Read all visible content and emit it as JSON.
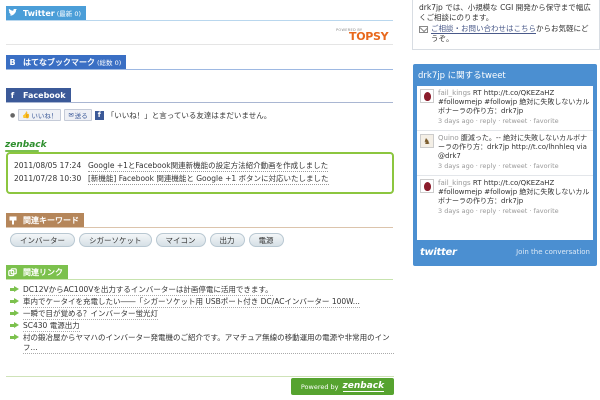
{
  "twitter_section": {
    "title": "Twitter",
    "count": "(最新 0)",
    "icon": "twitter-bird-icon",
    "topsy_powered": "POWERED BY",
    "topsy_logo": "TOPSY"
  },
  "hatena_section": {
    "title": "はてなブックマーク",
    "count": "(総数 0)",
    "icon": "hatena-b-icon"
  },
  "facebook_section": {
    "title": "Facebook",
    "icon": "facebook-f-icon",
    "like_label": "いいね！",
    "send_label": "送る",
    "message": "「いいね！」と言っている友達はまだいません。"
  },
  "zenback": {
    "logo": "zenback",
    "news": [
      {
        "date": "2011/08/05 17:24",
        "title": "Google +1とFacebook関連新機能の設定方法紹介動画を作成しました"
      },
      {
        "date": "2011/07/28 10:30",
        "title": "[新機能] Facebook 関連機能と Google +1 ボタンに対応いたしました"
      }
    ],
    "powered_by": "Powered by",
    "powered_logo": "zenback"
  },
  "keywords_section": {
    "title": "関連キーワード",
    "icon": "tag-icon",
    "items": [
      "インバーター",
      "シガーソケット",
      "マイコン",
      "出力",
      "電源"
    ]
  },
  "links_section": {
    "title": "関連リンク",
    "icon": "link-icon",
    "items": [
      "DC12VからAC100Vを出力するインバーターは計画停電に活用できます。",
      "車内でケータイを充電したい――「シガーソケット用 USBポート付き DC/ACインバーター 100W...",
      "一瞬で目が覚める？インバーター蛍光灯",
      "SC430 電源出力",
      "村の鍛冶屋からヤマハのインバーター発電機のご紹介です。アマチュア無線の移動運用の電源や非常用のインフ..."
    ]
  },
  "sidebar": {
    "contact_text_1": "drk7jp では、小規模な CGI 開発から保守まで幅広くご相談にのります。",
    "contact_link": "ご相談・お問い合わせはこちら",
    "contact_text_2": "からお気軽にどうぞ。",
    "widget_title": "drk7jp に関するtweet",
    "tweets": [
      {
        "user": "fail_kings",
        "text": "RT http://t.co/QKEZaHZ #followmejp #followjp 絶対に失敗しないカルボナーラの作り方：drk7jp",
        "meta": "3 days ago · reply · retweet · favorite",
        "avatar": "egg-avatar"
      },
      {
        "user": "Quino",
        "text": "腹減った。-- 絶対に失敗しないカルボナーラの作り方：drk7jp http://t.co/lhnhleq via @drk7",
        "meta": "3 days ago · reply · retweet · favorite",
        "avatar": "user-avatar"
      },
      {
        "user": "fail_kings",
        "text": "RT http://t.co/QKEZaHZ #followmejp #followjp 絶対に失敗しないカルボナーラの作り方：drk7jp",
        "meta": "3 days ago · reply · retweet · favorite",
        "avatar": "egg-avatar"
      }
    ],
    "twitter_logo": "twitter",
    "join_text": "Join the conversation"
  },
  "colors": {
    "twitter_blue": "#4b9ed8",
    "hatena_blue": "#3a6fc4",
    "facebook_blue": "#3b5998",
    "keyword_brown": "#b5865a",
    "link_green": "#7cc14d",
    "widget_blue": "#4b8fd1"
  }
}
